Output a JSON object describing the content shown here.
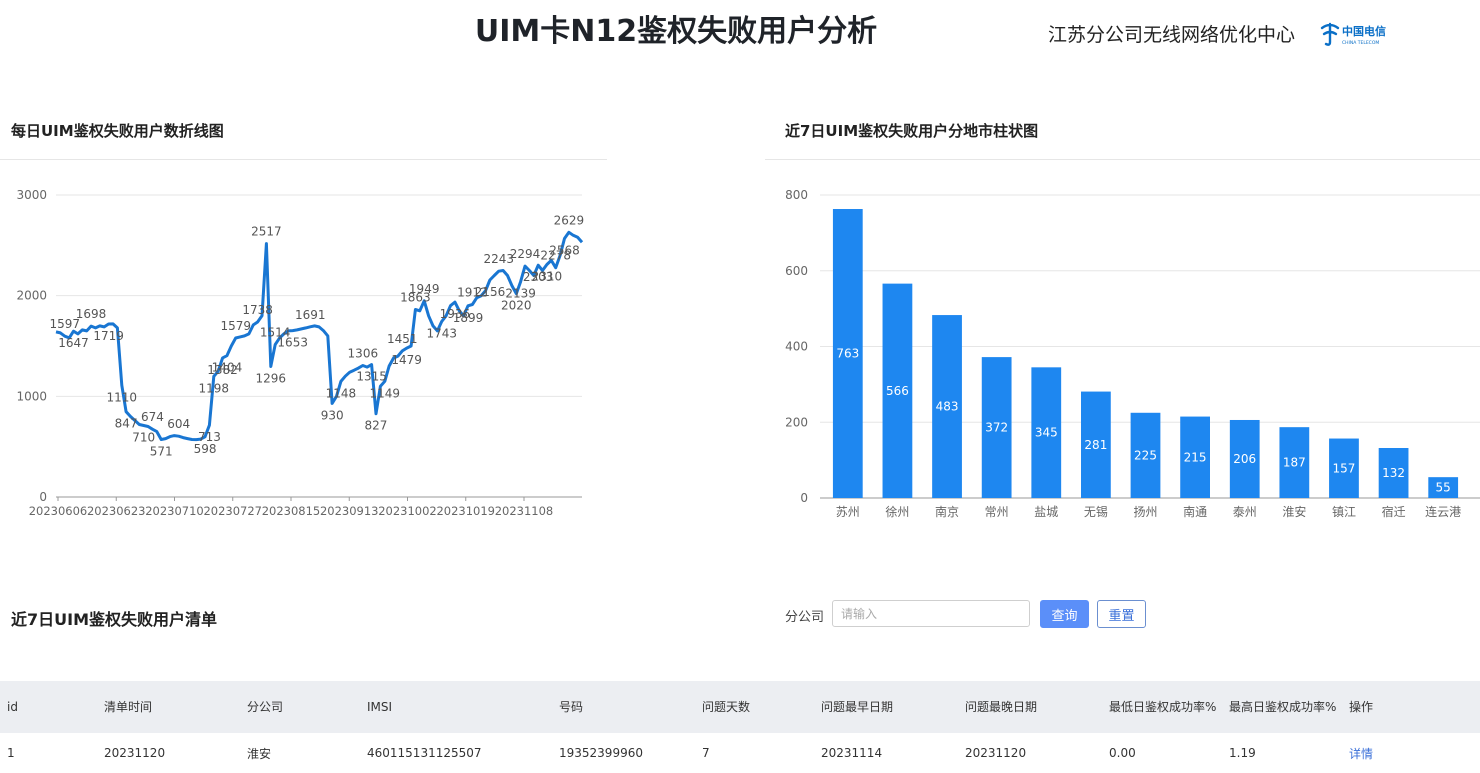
{
  "header": {
    "title": "UIM卡N12鉴权失败用户分析",
    "org": "江苏分公司无线网络优化中心",
    "logo_text": "中国电信",
    "logo_sub": "CHINA TELECOM",
    "logo_color": "#0a6fc7"
  },
  "line_panel": {
    "title": "每日UIM鉴权失败用户数折线图"
  },
  "bar_panel": {
    "title": "近7日UIM鉴权失败用户分地市柱状图"
  },
  "list_panel": {
    "title": "近7日UIM鉴权失败用户清单"
  },
  "filter": {
    "label": "分公司",
    "placeholder": "请输入",
    "value": "",
    "query_label": "查询",
    "reset_label": "重置"
  },
  "table": {
    "headers": [
      "id",
      "清单时间",
      "分公司",
      "IMSI",
      "号码",
      "问题天数",
      "问题最早日期",
      "问题最晚日期",
      "最低日鉴权成功率%",
      "最高日鉴权成功率%",
      "操作"
    ],
    "rows": [
      {
        "id": "1",
        "list_time": "20231120",
        "branch": "淮安",
        "imsi": "460115131125507",
        "number": "19352399960",
        "days": "7",
        "earliest": "20231114",
        "latest": "20231120",
        "min_rate": "0.00",
        "max_rate": "1.19",
        "action": "详情"
      }
    ]
  },
  "chart_data": [
    {
      "type": "line",
      "series_color": "#1976d2",
      "ylim": [
        0,
        3000
      ],
      "yticks": [
        "0",
        "1000",
        "2000",
        "3000"
      ],
      "xticks": [
        "20230606",
        "20230623",
        "20230710",
        "20230727",
        "20230815",
        "20230913",
        "20231002",
        "20231019",
        "20231108"
      ],
      "grid": true,
      "values": [
        1640,
        1630,
        1597,
        1580,
        1647,
        1620,
        1660,
        1650,
        1698,
        1680,
        1700,
        1690,
        1719,
        1720,
        1680,
        1110,
        847,
        800,
        760,
        720,
        710,
        700,
        674,
        650,
        571,
        580,
        600,
        610,
        604,
        590,
        580,
        571,
        570,
        575,
        598,
        713,
        1198,
        1250,
        1382,
        1404,
        1500,
        1579,
        1590,
        1600,
        1620,
        1710,
        1738,
        1800,
        2517,
        1296,
        1514,
        1580,
        1620,
        1650,
        1653,
        1660,
        1670,
        1680,
        1691,
        1700,
        1690,
        1653,
        1600,
        930,
        1000,
        1148,
        1200,
        1240,
        1260,
        1280,
        1306,
        1290,
        1315,
        827,
        1100,
        1149,
        1300,
        1380,
        1400,
        1451,
        1479,
        1500,
        1863,
        1850,
        1949,
        1800,
        1700,
        1650,
        1743,
        1800,
        1900,
        1936,
        1850,
        1800,
        1899,
        1912,
        1980,
        2000,
        2050,
        2156,
        2200,
        2243,
        2250,
        2200,
        2100,
        2020,
        2139,
        2294,
        2250,
        2200,
        2303,
        2250,
        2310,
        2350,
        2278,
        2400,
        2568,
        2629,
        2600,
        2580,
        2530
      ],
      "labels": [
        {
          "i": 2,
          "text": "1597",
          "pos": "above"
        },
        {
          "i": 4,
          "text": "1647",
          "pos": "below"
        },
        {
          "i": 8,
          "text": "1698",
          "pos": "above"
        },
        {
          "i": 12,
          "text": "1719",
          "pos": "below"
        },
        {
          "i": 15,
          "text": "1110",
          "pos": "below"
        },
        {
          "i": 16,
          "text": "847",
          "pos": "below"
        },
        {
          "i": 20,
          "text": "710",
          "pos": "below"
        },
        {
          "i": 22,
          "text": "674",
          "pos": "above"
        },
        {
          "i": 24,
          "text": "571",
          "pos": "below"
        },
        {
          "i": 28,
          "text": "604",
          "pos": "above"
        },
        {
          "i": 34,
          "text": "598",
          "pos": "below"
        },
        {
          "i": 35,
          "text": "713",
          "pos": "below"
        },
        {
          "i": 36,
          "text": "1198",
          "pos": "below"
        },
        {
          "i": 38,
          "text": "1382",
          "pos": "below"
        },
        {
          "i": 39,
          "text": "1404",
          "pos": "below"
        },
        {
          "i": 41,
          "text": "1579",
          "pos": "above"
        },
        {
          "i": 46,
          "text": "1738",
          "pos": "above"
        },
        {
          "i": 48,
          "text": "2517",
          "pos": "above"
        },
        {
          "i": 49,
          "text": "1296",
          "pos": "below"
        },
        {
          "i": 50,
          "text": "1514",
          "pos": "above"
        },
        {
          "i": 54,
          "text": "1653",
          "pos": "below"
        },
        {
          "i": 58,
          "text": "1691",
          "pos": "above"
        },
        {
          "i": 63,
          "text": "930",
          "pos": "below"
        },
        {
          "i": 65,
          "text": "1148",
          "pos": "below"
        },
        {
          "i": 70,
          "text": "1306",
          "pos": "above"
        },
        {
          "i": 72,
          "text": "1315",
          "pos": "below"
        },
        {
          "i": 73,
          "text": "827",
          "pos": "below"
        },
        {
          "i": 75,
          "text": "1149",
          "pos": "below"
        },
        {
          "i": 79,
          "text": "1451",
          "pos": "above"
        },
        {
          "i": 80,
          "text": "1479",
          "pos": "below"
        },
        {
          "i": 82,
          "text": "1863",
          "pos": "above"
        },
        {
          "i": 84,
          "text": "1949",
          "pos": "above"
        },
        {
          "i": 88,
          "text": "1743",
          "pos": "below"
        },
        {
          "i": 91,
          "text": "1936",
          "pos": "below"
        },
        {
          "i": 94,
          "text": "1899",
          "pos": "below"
        },
        {
          "i": 95,
          "text": "1912",
          "pos": "above"
        },
        {
          "i": 99,
          "text": "2156",
          "pos": "below"
        },
        {
          "i": 101,
          "text": "2243",
          "pos": "above"
        },
        {
          "i": 105,
          "text": "2020",
          "pos": "below"
        },
        {
          "i": 106,
          "text": "2139",
          "pos": "below"
        },
        {
          "i": 107,
          "text": "2294",
          "pos": "above"
        },
        {
          "i": 110,
          "text": "2303",
          "pos": "below"
        },
        {
          "i": 112,
          "text": "2310",
          "pos": "below"
        },
        {
          "i": 114,
          "text": "2278",
          "pos": "above"
        },
        {
          "i": 116,
          "text": "2568",
          "pos": "below"
        },
        {
          "i": 117,
          "text": "2629",
          "pos": "above"
        }
      ]
    },
    {
      "type": "bar",
      "bar_color": "#1e87f0",
      "ylim": [
        0,
        800
      ],
      "yticks": [
        "0",
        "200",
        "400",
        "600",
        "800"
      ],
      "grid": true,
      "categories": [
        "苏州",
        "徐州",
        "南京",
        "常州",
        "盐城",
        "无锡",
        "扬州",
        "南通",
        "泰州",
        "淮安",
        "镇江",
        "宿迁",
        "连云港"
      ],
      "values": [
        763,
        566,
        483,
        372,
        345,
        281,
        225,
        215,
        206,
        187,
        157,
        132,
        55
      ]
    }
  ]
}
